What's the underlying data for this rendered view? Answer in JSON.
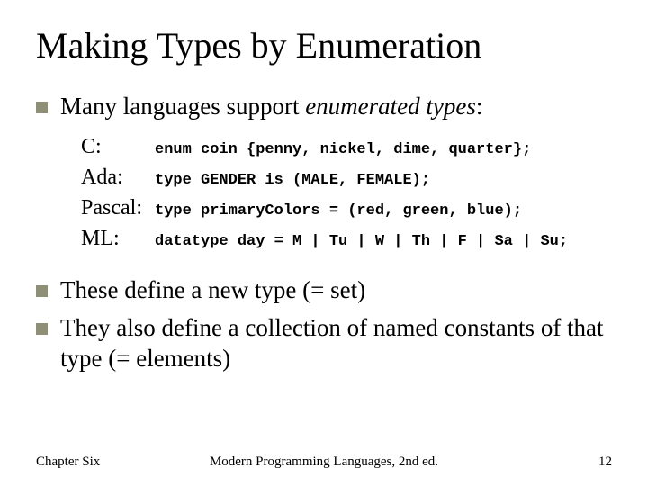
{
  "title": "Making Types by Enumeration",
  "bullets": {
    "b1_pre": "Many languages support ",
    "b1_em": "enumerated types",
    "b1_post": ":",
    "b2": "These define a new type (= set)",
    "b3": "They also define a collection of named constants of that type (= elements)"
  },
  "code": {
    "rows": [
      {
        "lang": "C:",
        "code": "enum coin {penny, nickel, dime, quarter};"
      },
      {
        "lang": "Ada:",
        "code": "type GENDER is (MALE, FEMALE);"
      },
      {
        "lang": "Pascal:",
        "code": "type primaryColors = (red, green, blue);"
      },
      {
        "lang": "ML:",
        "code": "datatype day = M | Tu | W | Th | F | Sa | Su;"
      }
    ]
  },
  "footer": {
    "left": "Chapter Six",
    "center": "Modern Programming Languages, 2nd ed.",
    "right": "12"
  },
  "colors": {
    "bullet": "#8f8f77"
  }
}
